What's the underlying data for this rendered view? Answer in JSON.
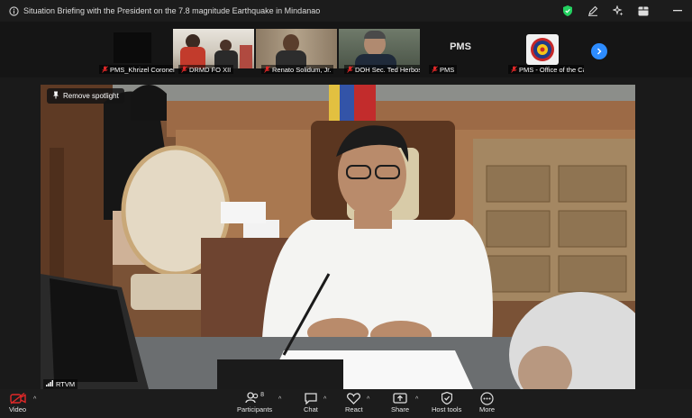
{
  "window": {
    "title": "Situation Briefing with the President on the 7.8 magnitude Earthquake in Mindanao"
  },
  "participants_strip": {
    "tiles": [
      {
        "name": "PMS_Khrizel Coronel-...",
        "video": "off"
      },
      {
        "name": "DRMD FO XII",
        "video": "on"
      },
      {
        "name": "Renato Solidum, Jr.",
        "video": "on"
      },
      {
        "name": "DOH Sec. Ted Herbosa",
        "video": "on"
      },
      {
        "name": "PMS",
        "video": "off",
        "placeholder": "PMS"
      },
      {
        "name": "PMS - Office of the Ca...",
        "video": "logo"
      }
    ]
  },
  "spotlight": {
    "remove_label": "Remove spotlight",
    "speaker_label": "RTVM"
  },
  "toolbar": {
    "video_label": "Video",
    "participants_label": "Participants",
    "participants_count": "8",
    "chat_label": "Chat",
    "react_label": "React",
    "share_label": "Share",
    "host_tools_label": "Host tools",
    "more_label": "More"
  },
  "colors": {
    "accent": "#2d8cff",
    "security_green": "#23d160",
    "mic_off_red": "#e02828"
  }
}
